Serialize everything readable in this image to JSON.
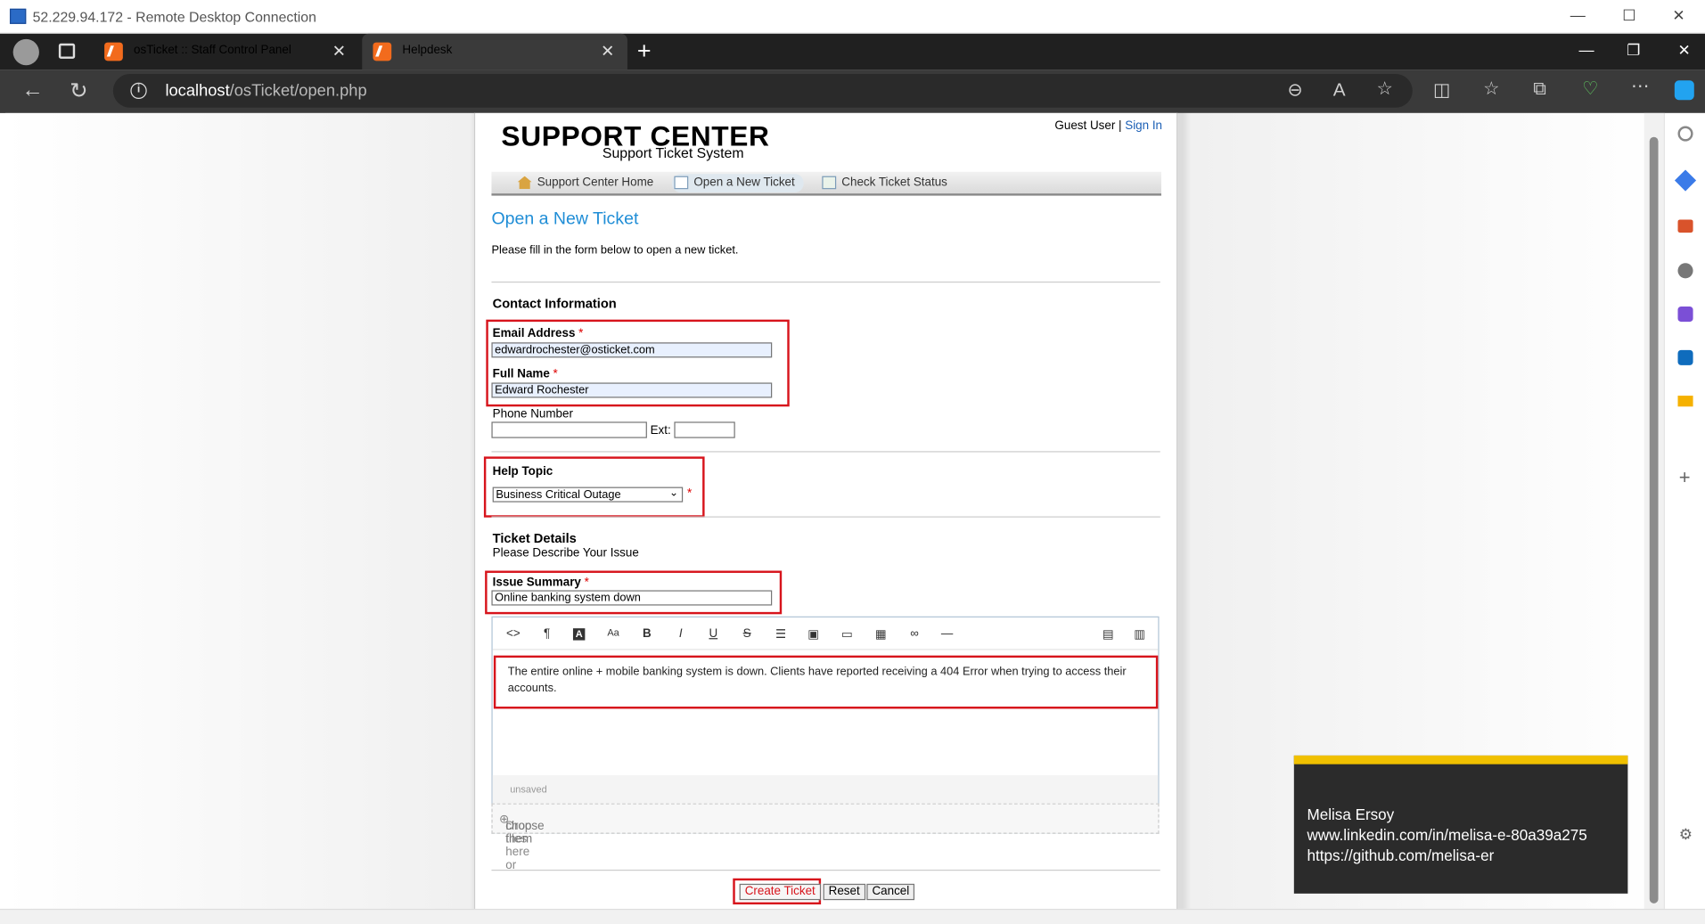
{
  "rdp": {
    "title": "52.229.94.172 - Remote Desktop Connection",
    "min": "—",
    "max": "☐",
    "close": "✕"
  },
  "browser": {
    "tabs": [
      {
        "label": "osTicket :: Staff Control Panel",
        "close": "✕"
      },
      {
        "label": "Helpdesk",
        "close": "✕"
      }
    ],
    "new_tab": "+",
    "url_host": "localhost",
    "url_path": "/osTicket/open.php",
    "win_min": "—",
    "win_max": "❐",
    "win_close": "✕"
  },
  "site": {
    "logo_main": "SUPPORT CENTER",
    "logo_sub": "Support Ticket System",
    "guest_label": "Guest User |",
    "sign_in": "Sign In",
    "nav": [
      "Support Center Home",
      "Open a New Ticket",
      "Check Ticket Status"
    ]
  },
  "form": {
    "title": "Open a New Ticket",
    "intro": "Please fill in the form below to open a new ticket.",
    "contact_heading": "Contact Information",
    "email_label": "Email Address",
    "email_value": "edwardrochester@osticket.com",
    "name_label": "Full Name",
    "name_value": "Edward Rochester",
    "phone_label": "Phone Number",
    "ext_label": "Ext:",
    "required_mark": "*",
    "help_topic_label": "Help Topic",
    "help_topic_value": "Business Critical Outage",
    "details_heading": "Ticket Details",
    "details_sub": "Please Describe Your Issue",
    "summary_label": "Issue Summary",
    "summary_value": "Online banking system down",
    "body_text": "The entire online + mobile banking system is down. Clients have reported receiving a 404 Error when trying to access their accounts.",
    "unsaved": "unsaved",
    "drop_text": "Drop files here or",
    "drop_link": "choose them",
    "buttons": {
      "create": "Create Ticket",
      "reset": "Reset",
      "cancel": "Cancel"
    }
  },
  "overlay": {
    "name": "Melisa Ersoy",
    "linkedin": "www.linkedin.com/in/melisa-e-80a39a275",
    "github": "https://github.com/melisa-er"
  },
  "colors": {
    "accent_red": "#d7141c",
    "title_blue": "#1f8dd6",
    "link_blue": "#1b5fb5",
    "overlay_bar": "#f0c000"
  }
}
